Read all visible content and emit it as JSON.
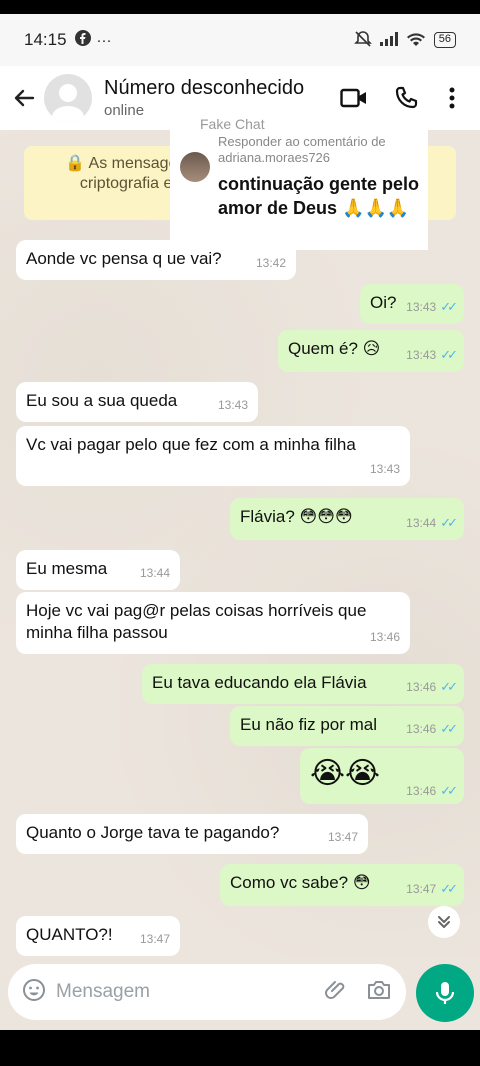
{
  "status_bar": {
    "time": "14:15",
    "battery": "56"
  },
  "header": {
    "contact_name": "Número desconhecido",
    "contact_status": "online"
  },
  "overlay": {
    "fake_chat_label": "Fake Chat"
  },
  "encryption_notice": "As mensagens e ligações são protegidas com criptografia e agora seguras contra ... para ...",
  "comment_card": {
    "reply_label": "Responder ao comentário de adriana.moraes726",
    "text": "continuação gente pelo amor de Deus 🙏🙏🙏"
  },
  "messages": [
    {
      "text": "Aonde vc pensa q ue vai?",
      "time": "13:42",
      "dir": "in"
    },
    {
      "text": "Oi?",
      "time": "13:43",
      "dir": "out"
    },
    {
      "text": "Quem é? 😥",
      "time": "13:43",
      "dir": "out"
    },
    {
      "text": "Eu sou a sua queda",
      "time": "13:43",
      "dir": "in"
    },
    {
      "text": "Vc vai pagar pelo que fez com a minha filha",
      "time": "13:43",
      "dir": "in"
    },
    {
      "text": "Flávia? 😳😳😳",
      "time": "13:44",
      "dir": "out"
    },
    {
      "text": "Eu mesma",
      "time": "13:44",
      "dir": "in"
    },
    {
      "text": "Hoje vc vai pag@r pelas coisas horríveis que minha filha passou",
      "time": "13:46",
      "dir": "in"
    },
    {
      "text": "Eu tava educando ela Flávia",
      "time": "13:46",
      "dir": "out"
    },
    {
      "text": "Eu não fiz por mal",
      "time": "13:46",
      "dir": "out"
    },
    {
      "text": "😭😭",
      "time": "13:46",
      "dir": "out"
    },
    {
      "text": "Quanto o Jorge tava te pagando?",
      "time": "13:47",
      "dir": "in"
    },
    {
      "text": "Como vc sabe? 😳",
      "time": "13:47",
      "dir": "out"
    },
    {
      "text": "QUANTO?!",
      "time": "13:47",
      "dir": "in"
    }
  ],
  "input": {
    "placeholder": "Mensagem"
  },
  "colors": {
    "accent": "#00a884",
    "outgoing": "#dcf8c6",
    "incoming": "#ffffff",
    "read_ticks": "#4fb6ec"
  }
}
